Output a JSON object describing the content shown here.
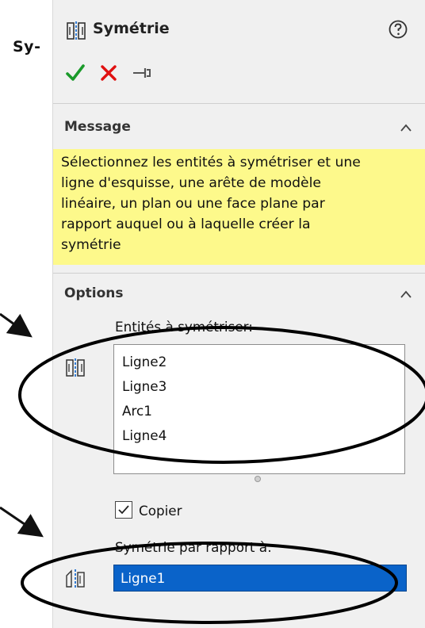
{
  "annotation": {
    "label": "Sy-"
  },
  "panel": {
    "title": "Symétrie",
    "header_icon": "mirror-entities-icon",
    "help_icon": "question-circle-icon",
    "actions": [
      {
        "name": "ok",
        "icon": "checkmark-icon",
        "color": "#1a9a2a"
      },
      {
        "name": "cancel",
        "icon": "x-icon",
        "color": "#e01010"
      },
      {
        "name": "pin",
        "icon": "pushpin-icon",
        "color": "#555555"
      }
    ]
  },
  "message_section": {
    "title": "Message",
    "lines": [
      "Sélectionnez les entités à symétriser et une",
      "ligne d'esquisse, une arête de modèle",
      "linéaire, un plan ou une face plane par",
      "rapport auquel ou à laquelle créer la",
      "symétrie"
    ],
    "background": "#fdf98b"
  },
  "options_section": {
    "title": "Options",
    "entities_label": "Entités à symétriser:",
    "entities": [
      "Ligne2",
      "Ligne3",
      "Arc1",
      "Ligne4"
    ],
    "copy_label": "Copier",
    "copy_checked": true,
    "reference_label": "Symétrie par rapport à:",
    "reference_value": "Ligne1",
    "selection_color": "#0a63c9"
  }
}
